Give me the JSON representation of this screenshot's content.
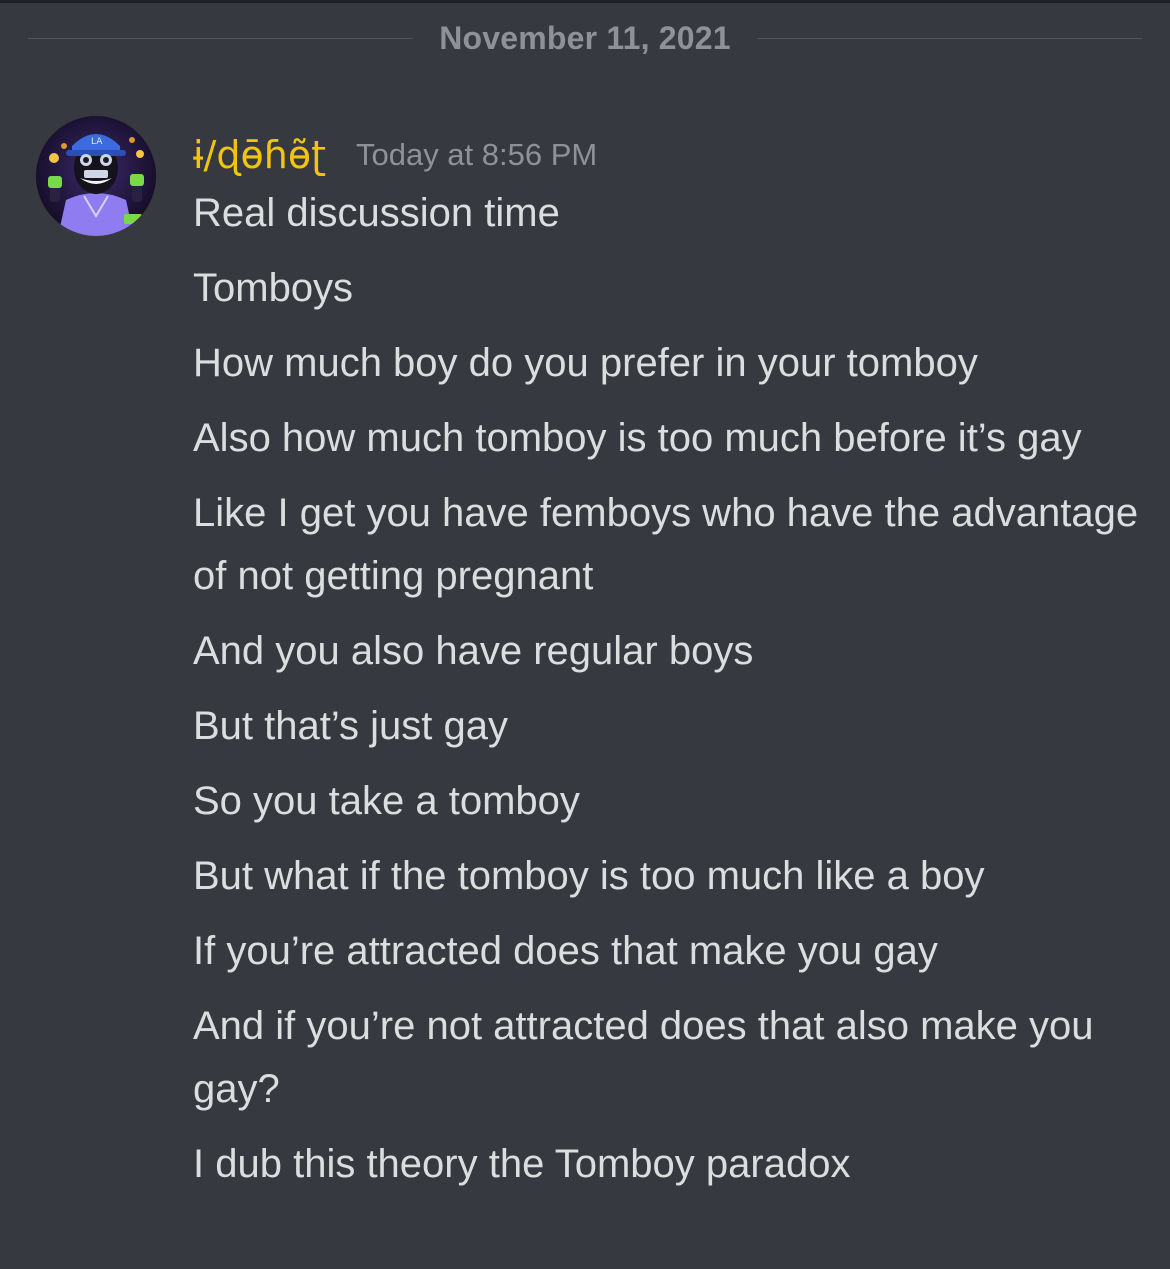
{
  "chat": {
    "date_divider": "November 11, 2021"
  },
  "message": {
    "author": {
      "username": "ɨ/ɖɵ̄ɦɵ̃ʈ",
      "avatar_icon": "user-avatar-icon"
    },
    "timestamp": "Today at 8:56 PM",
    "lines": [
      "Real discussion time",
      "Tomboys",
      "How much boy do you prefer in your tomboy",
      "Also how much tomboy is too much before it’s gay",
      "Like I get you have femboys who have the advantage of not getting pregnant",
      "And you also have regular boys",
      "But that’s just gay",
      "So you take a tomboy",
      "But what if the tomboy is too much like a boy",
      "If you’re attracted does that make you gay",
      "And if you’re not attracted does that also make you gay?",
      "I dub this theory the Tomboy paradox"
    ]
  },
  "colors": {
    "background": "#36393f",
    "username": "#f1c40f",
    "timestamp": "#8e9297",
    "message_text": "#dcddde"
  }
}
